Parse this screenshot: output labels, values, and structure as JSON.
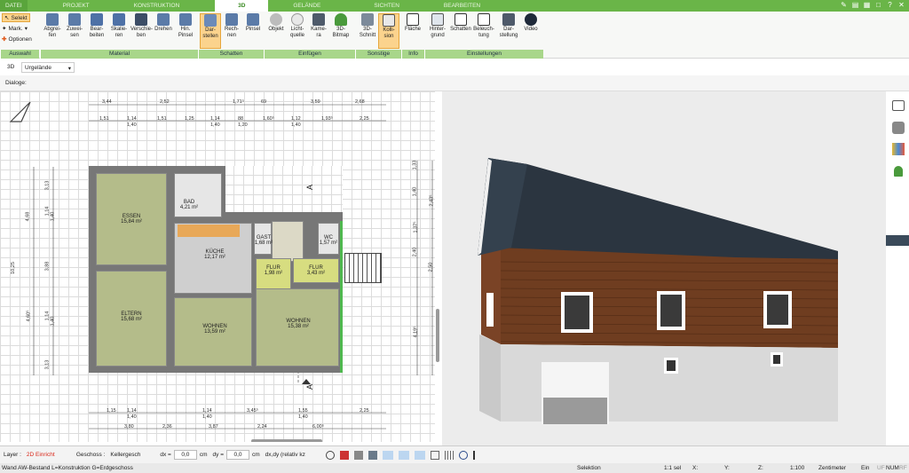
{
  "tabs": {
    "datei": "DATEI",
    "projekt": "PROJEKT",
    "konstruktion": "KONSTRUKTION",
    "d3": "3D",
    "gelaende": "GELÄNDE",
    "sichten": "SICHTEN",
    "bearbeiten": "BEARBEITEN"
  },
  "auswahl": {
    "selekt": "Selekt",
    "mark": "Mark.",
    "optionen": "Optionen",
    "group": "Auswahl"
  },
  "material": {
    "group": "Material",
    "items": [
      "Abgrei- fen",
      "Zuwei- sen",
      "Bear- beiten",
      "Skalie- ren",
      "Verschie- ben",
      "Drehen",
      "Hin. Pinsel"
    ]
  },
  "schatten": {
    "group": "Schatten",
    "items": [
      "Dar- stellen",
      "Rech- nen",
      "Pinsel"
    ]
  },
  "einfuegen": {
    "group": "Einfügen",
    "items": [
      "Objekt",
      "Licht- quelle",
      "Kame- ra",
      "3D- Bitmap"
    ]
  },
  "sonstige": {
    "group": "Sonstige",
    "items": [
      "3D- Schnitt",
      "Kolli- sion"
    ]
  },
  "info": {
    "group": "Info",
    "items": [
      "Fläche"
    ]
  },
  "einstellungen": {
    "group": "Einstellungen",
    "items": [
      "Hinter- grund",
      "Schatten",
      "Beleuch- tung",
      "Dar- stellung",
      "Video"
    ]
  },
  "toolbar2": {
    "mode": "3D",
    "terrain": "Urgelände"
  },
  "toolbar3": {
    "dialoge": "Dialoge:"
  },
  "plan": {
    "rooms": [
      {
        "name": "ESSEN",
        "area": "15,84 m²"
      },
      {
        "name": "BAD",
        "area": "4,21 m²"
      },
      {
        "name": "KÜCHE",
        "area": "12,17 m²"
      },
      {
        "name": "GAST",
        "area": "1,68 m²"
      },
      {
        "name": "WC",
        "area": "1,57 m²"
      },
      {
        "name": "FLUR",
        "area": "1,98 m²"
      },
      {
        "name": "FLUR",
        "area": "3,43 m²"
      },
      {
        "name": "ELTERN",
        "area": "15,68 m²"
      },
      {
        "name": "WOHNEN",
        "area": "13,59 m²"
      },
      {
        "name": "WOHNEN",
        "area": "15,38 m²"
      }
    ],
    "section_mark": "A",
    "dims_top1": [
      "3,44",
      "2,52",
      "1,71⁵",
      "69",
      "3,59",
      "2,68"
    ],
    "dims_top2": [
      "1,51",
      "1,14",
      "1,40",
      "1,51",
      "1,25",
      "1,14",
      "1,40",
      "88",
      "1,20",
      "1,60⁵",
      "1,12",
      "1,40",
      "1,93⁵",
      "2,25"
    ],
    "dims_bottom1": [
      "1,15",
      "1,14",
      "1,40",
      "1,14",
      "1,40",
      "3,45⁵",
      "1,55",
      "1,40",
      "2,25"
    ],
    "dims_bottom2": [
      "3,80",
      "2,36",
      "3,87",
      "2,24",
      "6,00⁵"
    ],
    "dims_left": [
      "3,13",
      "4,68",
      "1,14",
      "1,40",
      "10,25",
      "3,88",
      "4,60⁵",
      "1,14",
      "1,40",
      "3,13"
    ],
    "dims_right": [
      "1,33",
      "1,40",
      "2,43⁵",
      "1,37⁵",
      "2,40",
      "2,50",
      "4,19⁵"
    ]
  },
  "statusbar": {
    "layer_label": "Layer :",
    "layer_value": "2D Einricht",
    "geschoss_label": "Geschoss :",
    "geschoss_value": "Kellergesch",
    "dx_label": "dx =",
    "dx_value": "0,0",
    "dy_label": "dy =",
    "dy_value": "0,0",
    "unit": "cm",
    "mode": "dx,dy (relativ kz"
  },
  "footer": {
    "info": "Wand AW-Bestand L=Konstruktion G=Erdgeschoss",
    "mode": "Selektion",
    "sel": "1:1 sel",
    "x": "X:",
    "y": "Y:",
    "z": "Z:",
    "scale": "1:100",
    "unit": "Zentimeter",
    "ein": "Ein",
    "uf": "UF",
    "num": "NUM",
    "rf": "RF"
  },
  "colors": {
    "green": "#6ab548",
    "roof": "#2b3540",
    "wall": "#6b3a1e",
    "base": "#dcdcdc"
  }
}
